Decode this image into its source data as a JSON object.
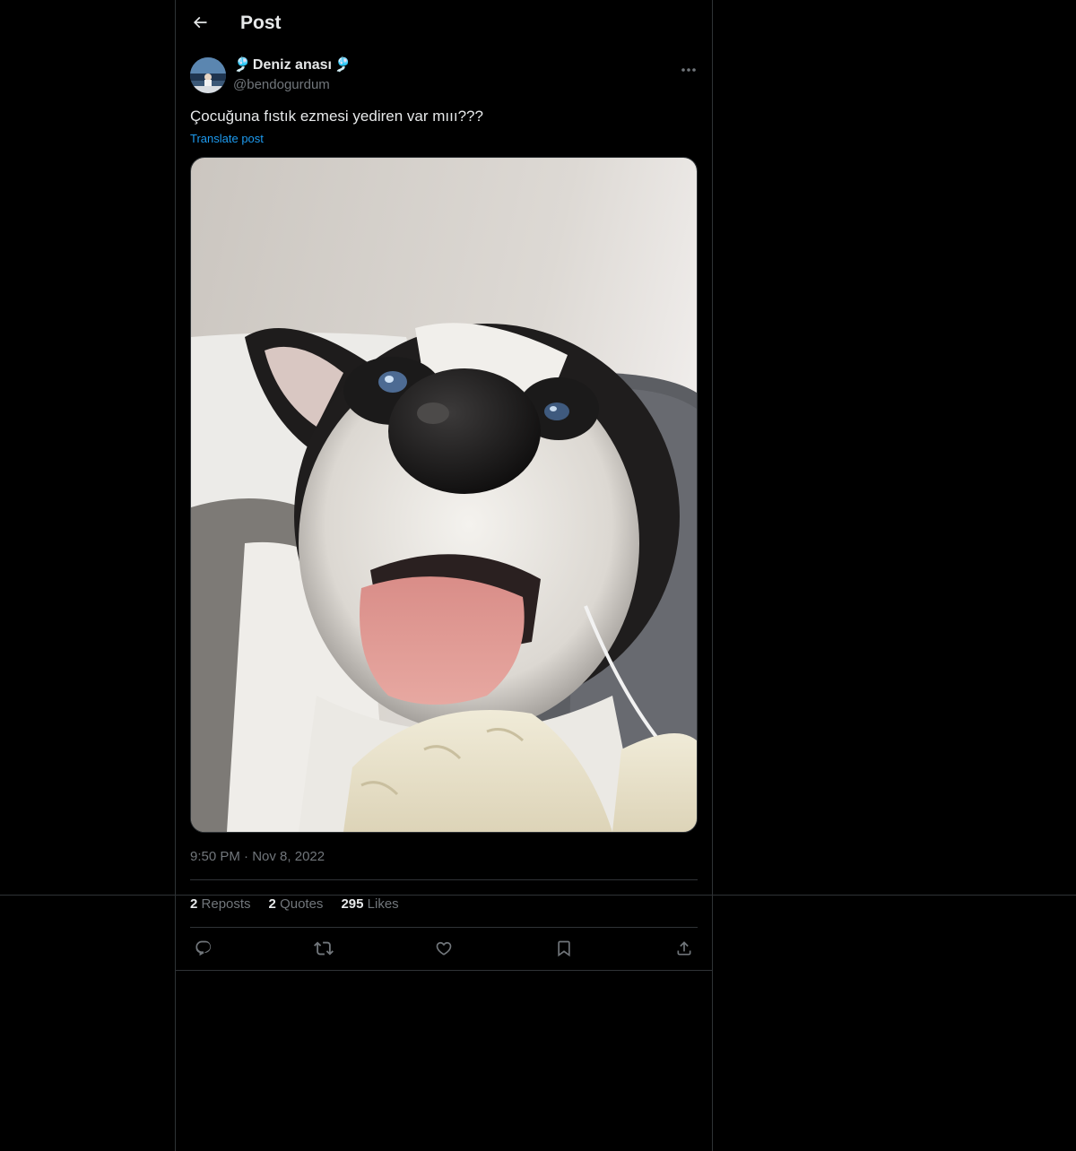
{
  "header": {
    "title": "Post",
    "back_icon": "arrow-left-icon"
  },
  "author": {
    "name": "Deniz anası",
    "name_emoji": "🎐",
    "handle": "@bendogurdum"
  },
  "post": {
    "text": "Çocuğuna fıstık ezmesi yediren var mııı???",
    "translate_label": "Translate post",
    "time": "9:50 PM",
    "separator": "·",
    "date": "Nov 8, 2022"
  },
  "stats": {
    "reposts_count": "2",
    "reposts_label": "Reposts",
    "quotes_count": "2",
    "quotes_label": "Quotes",
    "likes_count": "295",
    "likes_label": "Likes"
  },
  "actions": [
    {
      "icon": "reply-icon"
    },
    {
      "icon": "repost-icon"
    },
    {
      "icon": "like-icon"
    },
    {
      "icon": "bookmark-icon"
    },
    {
      "icon": "share-icon"
    }
  ],
  "colors": {
    "background": "#000000",
    "text_primary": "#e7e9ea",
    "text_secondary": "#71767b",
    "link": "#1d9bf0",
    "border": "#2f3336"
  }
}
